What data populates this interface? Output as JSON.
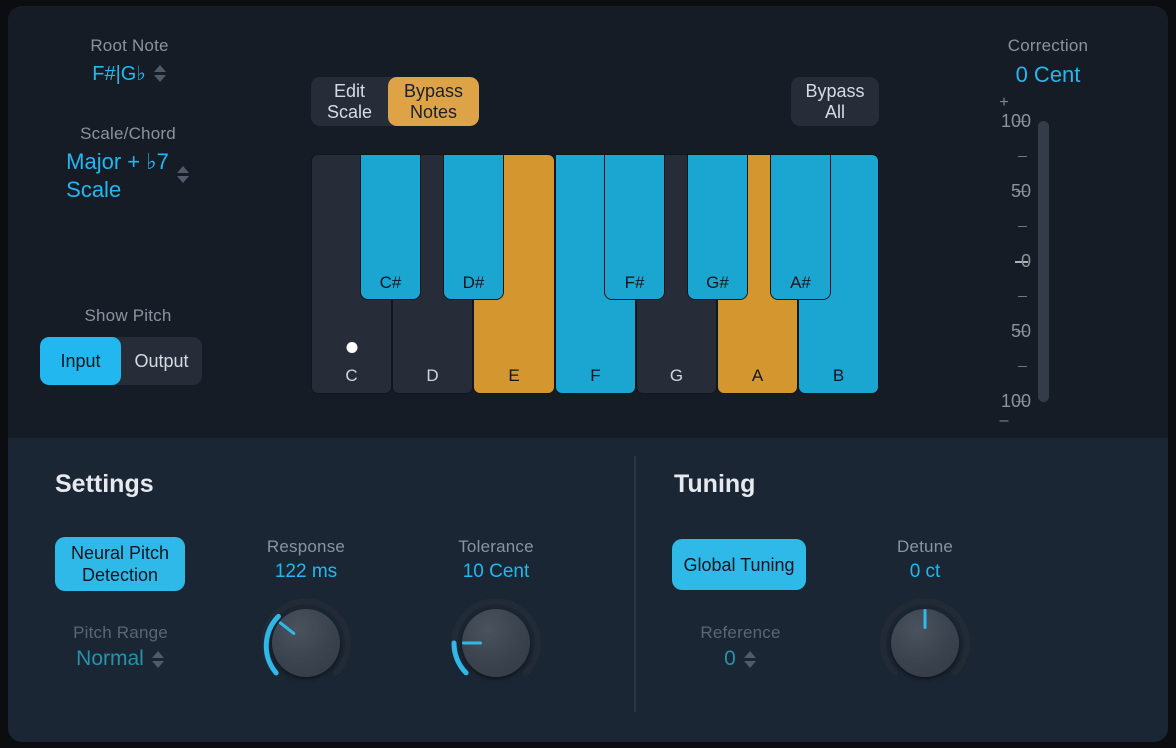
{
  "root_note": {
    "label": "Root Note",
    "value": "F#|G♭",
    "stepper_icon": "updown-arrows-icon"
  },
  "scale_chord": {
    "label": "Scale/Chord",
    "value": "Major + ♭7\nScale",
    "value_line1": "Major + ♭7",
    "value_line2": "Scale",
    "stepper_icon": "updown-arrows-icon"
  },
  "show_pitch": {
    "label": "Show Pitch",
    "options": [
      {
        "label": "Input",
        "active": true
      },
      {
        "label": "Output",
        "active": false
      }
    ]
  },
  "scale_buttons": [
    {
      "line1": "Edit",
      "line2": "Scale",
      "active": false
    },
    {
      "line1": "Bypass",
      "line2": "Notes",
      "active": true
    }
  ],
  "bypass_all": {
    "line1": "Bypass",
    "line2": "All"
  },
  "keyboard": {
    "white_keys": [
      {
        "name": "C",
        "state": "off",
        "root_dot": true
      },
      {
        "name": "D",
        "state": "off",
        "root_dot": false
      },
      {
        "name": "E",
        "state": "orange",
        "root_dot": false
      },
      {
        "name": "F",
        "state": "blue",
        "root_dot": false
      },
      {
        "name": "G",
        "state": "off",
        "root_dot": false
      },
      {
        "name": "A",
        "state": "orange",
        "root_dot": false
      },
      {
        "name": "B",
        "state": "blue",
        "root_dot": false
      }
    ],
    "black_keys": [
      {
        "name": "C#",
        "state": "blue"
      },
      {
        "name": "D#",
        "state": "blue"
      },
      {
        "name": "F#",
        "state": "blue"
      },
      {
        "name": "G#",
        "state": "blue"
      },
      {
        "name": "A#",
        "state": "blue"
      }
    ]
  },
  "correction": {
    "label": "Correction",
    "value": "0 Cent",
    "plus": "+",
    "minus": "–",
    "ticks": [
      "100",
      "50",
      "0",
      "50",
      "100"
    ]
  },
  "settings": {
    "title": "Settings",
    "neural_pitch_detection": {
      "line1": "Neural Pitch",
      "line2": "Detection",
      "active": true
    },
    "pitch_range": {
      "label": "Pitch Range",
      "value": "Normal",
      "stepper_icon": "updown-arrows-icon"
    },
    "response": {
      "label": "Response",
      "value": "122 ms",
      "angle": -52
    },
    "tolerance": {
      "label": "Tolerance",
      "value": "10 Cent",
      "angle": -90
    }
  },
  "tuning": {
    "title": "Tuning",
    "global_tuning": {
      "label": "Global Tuning",
      "active": true
    },
    "reference": {
      "label": "Reference",
      "value": "0",
      "stepper_icon": "updown-arrows-icon"
    },
    "detune": {
      "label": "Detune",
      "value": "0 ct",
      "angle": 0
    }
  },
  "colors": {
    "accent_blue": "#22b8ef",
    "key_blue": "#1ba6d2",
    "key_orange": "#d4962f",
    "panel_top": "#161c26",
    "panel_bottom": "#1b2634"
  }
}
